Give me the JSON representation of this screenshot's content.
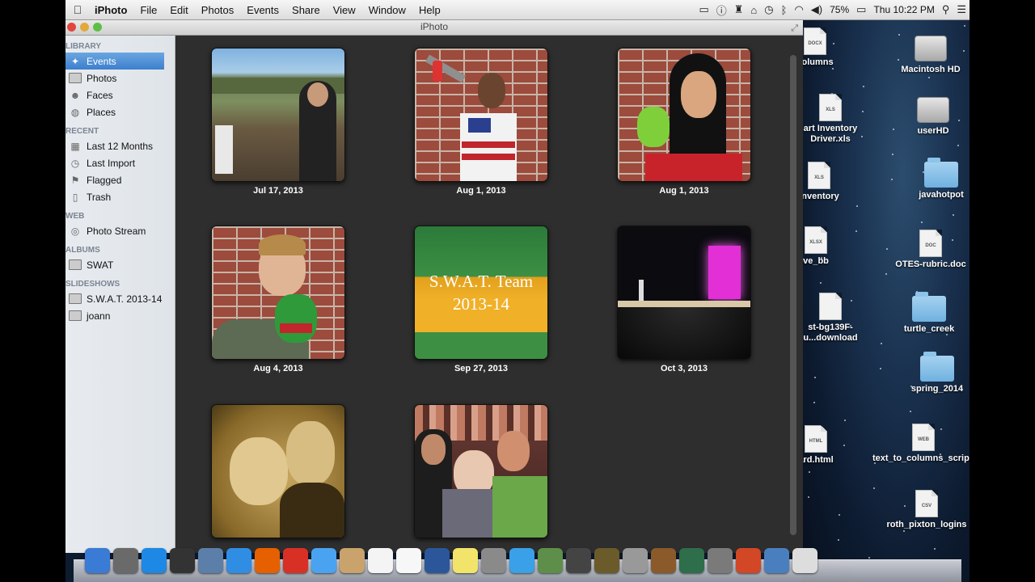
{
  "menubar": {
    "app": "iPhoto",
    "items": [
      "File",
      "Edit",
      "Photos",
      "Events",
      "Share",
      "View",
      "Window",
      "Help"
    ],
    "battery": "75%",
    "clock": "Thu 10:22 PM"
  },
  "window": {
    "title": "iPhoto"
  },
  "sidebar": {
    "sections": [
      {
        "title": "LIBRARY",
        "items": [
          {
            "label": "Events",
            "icon": "events-icon",
            "selected": true
          },
          {
            "label": "Photos",
            "icon": "photos-icon"
          },
          {
            "label": "Faces",
            "icon": "faces-icon"
          },
          {
            "label": "Places",
            "icon": "places-icon"
          }
        ]
      },
      {
        "title": "RECENT",
        "items": [
          {
            "label": "Last 12 Months",
            "icon": "calendar-icon"
          },
          {
            "label": "Last Import",
            "icon": "clock-icon"
          },
          {
            "label": "Flagged",
            "icon": "flag-icon"
          },
          {
            "label": "Trash",
            "icon": "trash-icon"
          }
        ]
      },
      {
        "title": "WEB",
        "items": [
          {
            "label": "Photo Stream",
            "icon": "photo-stream-icon"
          }
        ]
      },
      {
        "title": "ALBUMS",
        "items": [
          {
            "label": "SWAT",
            "icon": "album-icon"
          }
        ]
      },
      {
        "title": "SLIDESHOWS",
        "items": [
          {
            "label": "S.W.A.T. 2013-14",
            "icon": "slideshow-icon"
          },
          {
            "label": "joann",
            "icon": "slideshow-icon"
          }
        ]
      }
    ]
  },
  "events": [
    {
      "date": "Jul 17, 2013",
      "scene": "outdoor"
    },
    {
      "date": "Aug 1, 2013",
      "scene": "boy-brick"
    },
    {
      "date": "Aug 1, 2013",
      "scene": "girl-brick"
    },
    {
      "date": "Aug 4, 2013",
      "scene": "boy-frog"
    },
    {
      "date": "Sep 27, 2013",
      "scene": "swat-card",
      "card_line1": "S.W.A.T. Team",
      "card_line2": "2013-14"
    },
    {
      "date": "Oct 3, 2013",
      "scene": "stage"
    },
    {
      "date": "",
      "scene": "sepia"
    },
    {
      "date": "",
      "scene": "crowd"
    }
  ],
  "desktop": {
    "icons": [
      {
        "label": "columns",
        "kind": "doc",
        "tag": "DOCX"
      },
      {
        "label": "Macintosh HD",
        "kind": "hdd"
      },
      {
        "label": "art Inventory Driver.xls",
        "kind": "doc",
        "tag": "XLS"
      },
      {
        "label": "userHD",
        "kind": "hdd"
      },
      {
        "label": "inventory",
        "kind": "doc",
        "tag": "XLS"
      },
      {
        "label": "javahotpot",
        "kind": "folder"
      },
      {
        "label": "ve_bb",
        "kind": "doc",
        "tag": "XLSX"
      },
      {
        "label": "OTES-rubric.doc",
        "kind": "doc",
        "tag": "DOC"
      },
      {
        "label": "st-bg139F-u...download",
        "kind": "doc",
        "tag": ""
      },
      {
        "label": "turtle_creek",
        "kind": "folder"
      },
      {
        "label": "spring_2014",
        "kind": "folder"
      },
      {
        "label": "ard.html",
        "kind": "doc",
        "tag": "HTML"
      },
      {
        "label": "text_to_columns_script.webarchive",
        "kind": "doc",
        "tag": "WEB"
      },
      {
        "label": "roth_pixton_logins",
        "kind": "doc",
        "tag": "CSV"
      }
    ]
  },
  "dock": {
    "apps": [
      {
        "name": "finder-icon",
        "color": "#3a7bd5"
      },
      {
        "name": "launchpad-icon",
        "color": "#6a6a6a"
      },
      {
        "name": "app-store-icon",
        "color": "#1e88e5"
      },
      {
        "name": "dashboard-icon",
        "color": "#333"
      },
      {
        "name": "preview-icon",
        "color": "#5b7fa8"
      },
      {
        "name": "safari-icon",
        "color": "#2f8de4"
      },
      {
        "name": "firefox-icon",
        "color": "#e66000"
      },
      {
        "name": "chrome-icon",
        "color": "#d93025"
      },
      {
        "name": "messages-icon",
        "color": "#4aa3f0"
      },
      {
        "name": "contacts-icon",
        "color": "#c9a36b"
      },
      {
        "name": "calendar-icon",
        "color": "#f4f4f4"
      },
      {
        "name": "reminders-icon",
        "color": "#f7f7f7"
      },
      {
        "name": "word-icon",
        "color": "#2b579a"
      },
      {
        "name": "stickies-icon",
        "color": "#f2e36b"
      },
      {
        "name": "photo-booth-icon",
        "color": "#8a8a8a"
      },
      {
        "name": "itunes-icon",
        "color": "#3aa0e8"
      },
      {
        "name": "iphoto-icon",
        "color": "#5e8f4a"
      },
      {
        "name": "final-cut-icon",
        "color": "#444"
      },
      {
        "name": "imovie-icon",
        "color": "#6b5b2a"
      },
      {
        "name": "photo-import-icon",
        "color": "#999"
      },
      {
        "name": "garageband-icon",
        "color": "#8a5a2b"
      },
      {
        "name": "time-machine-icon",
        "color": "#2e6e4a"
      },
      {
        "name": "system-preferences-icon",
        "color": "#7a7a7a"
      },
      {
        "name": "powerpoint-icon",
        "color": "#d24726"
      },
      {
        "name": "network-utility-icon",
        "color": "#4a7fbf"
      },
      {
        "name": "dvd-player-icon",
        "color": "#ddd"
      }
    ]
  },
  "colors": {
    "accent": "#3d7fcd",
    "content_bg": "#2e2e2e",
    "sidebar_bg": "#e3e7ec"
  }
}
